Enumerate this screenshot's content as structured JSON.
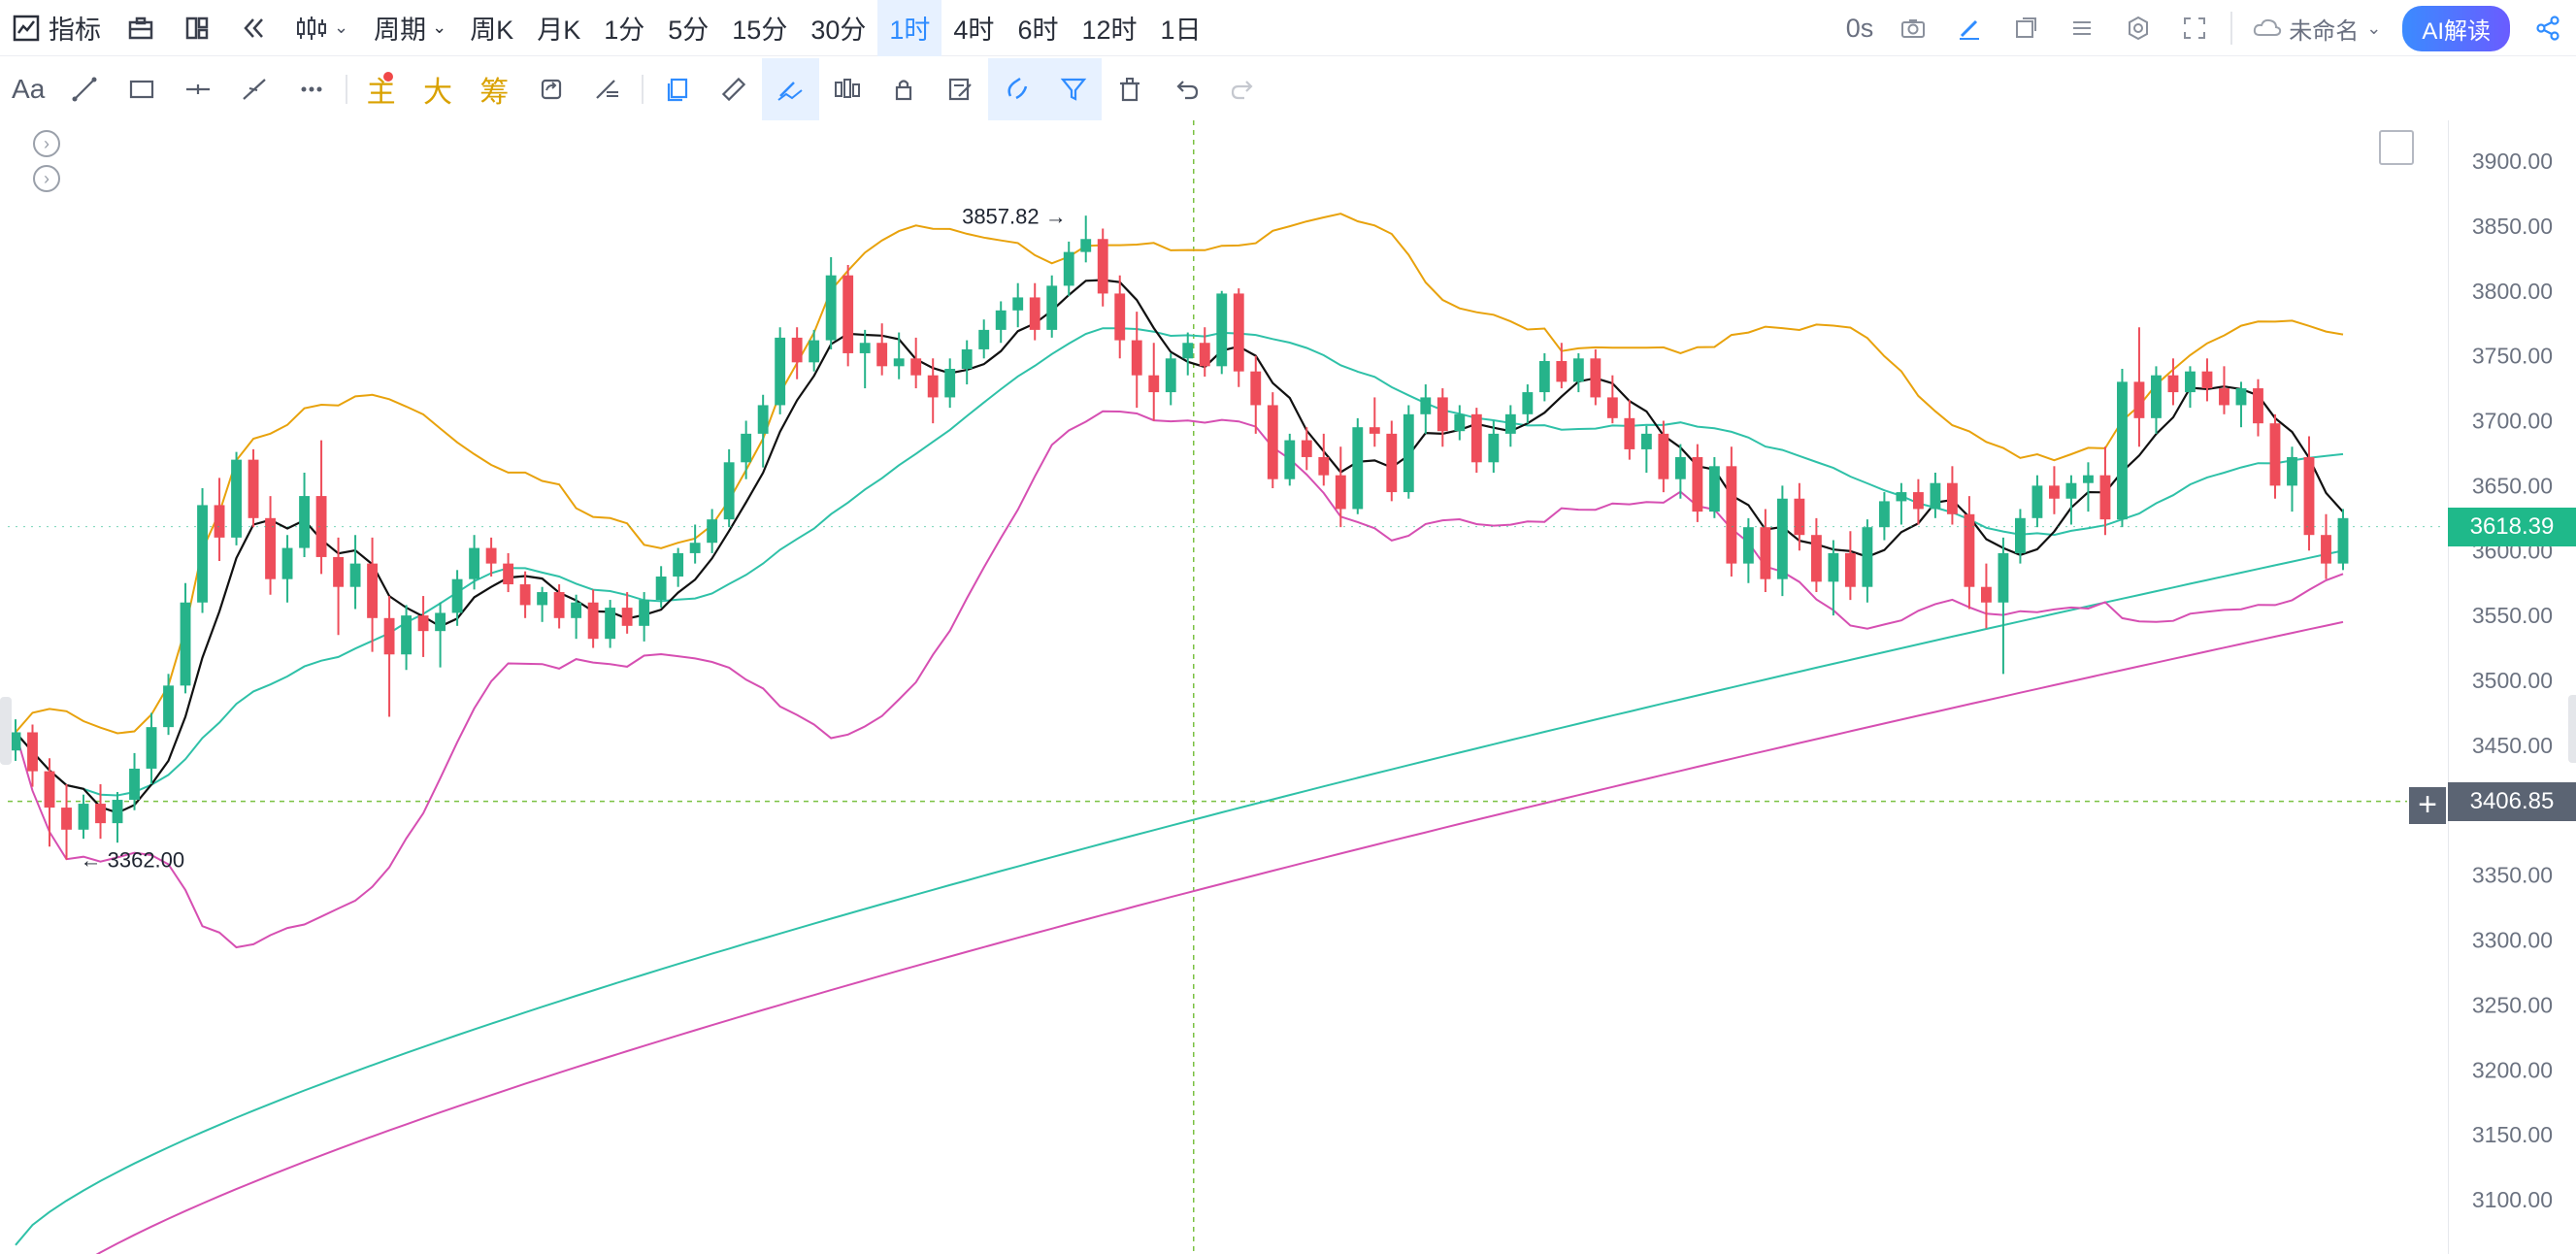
{
  "toolbar": {
    "indicator_label": "指标",
    "period_label": "周期",
    "periods": [
      "周K",
      "月K",
      "1分",
      "5分",
      "15分",
      "30分",
      "1时",
      "4时",
      "6时",
      "12时",
      "1日"
    ],
    "active_period": "1时",
    "latency": "0s",
    "layout_name": "未命名",
    "ai_label": "AI解读"
  },
  "drawing_tools": {
    "text_label": "Aa",
    "main_label": "主",
    "big_label": "大",
    "chip_label": "筹"
  },
  "colors": {
    "up": "#26b38a",
    "down": "#ee4d5a",
    "ma_black": "#111111",
    "boll_upper": "#e8a20c",
    "boll_lower": "#d64fb2",
    "ma_teal": "#2fc1a8",
    "grid_dash": "#7bc143",
    "price_tag": "#1fb98a",
    "cross_tag": "#5b6473"
  },
  "chart_data": {
    "type": "candlestick",
    "symbol": "",
    "interval": "1时",
    "y_axis": {
      "min": 3080,
      "max": 3930,
      "ticks": [
        3900,
        3850,
        3800,
        3750,
        3700,
        3650,
        3600,
        3550,
        3500,
        3450,
        3400,
        3350,
        3300,
        3250,
        3200,
        3150,
        3100
      ],
      "tick_labels": [
        "3900.00",
        "3850.00",
        "3800.00",
        "3750.00",
        "3700.00",
        "3650.00",
        "3600.00",
        "3550.00",
        "3500.00",
        "3450.00",
        "3400.00",
        "3350.00",
        "3300.00",
        "3250.00",
        "3200.00",
        "3150.00",
        "3100.00"
      ]
    },
    "last_price": 3618.39,
    "last_price_label": "3618.39",
    "crosshair_price": 3406.85,
    "crosshair_label": "3406.85",
    "crosshair_bar_index": 69,
    "annotations": [
      {
        "label": "3857.82",
        "price": 3857.82,
        "bar_index": 63,
        "side": "left"
      },
      {
        "label": "3362.00",
        "price": 3362.0,
        "bar_index": 3,
        "side": "right"
      }
    ],
    "candles": [
      [
        3446,
        3470,
        3438,
        3460
      ],
      [
        3460,
        3466,
        3418,
        3430
      ],
      [
        3430,
        3440,
        3372,
        3402
      ],
      [
        3402,
        3420,
        3362,
        3385
      ],
      [
        3385,
        3412,
        3378,
        3405
      ],
      [
        3405,
        3420,
        3378,
        3390
      ],
      [
        3390,
        3414,
        3375,
        3408
      ],
      [
        3408,
        3444,
        3400,
        3432
      ],
      [
        3432,
        3475,
        3420,
        3464
      ],
      [
        3464,
        3505,
        3458,
        3496
      ],
      [
        3496,
        3575,
        3490,
        3560
      ],
      [
        3560,
        3648,
        3552,
        3635
      ],
      [
        3635,
        3656,
        3592,
        3610
      ],
      [
        3610,
        3676,
        3604,
        3670
      ],
      [
        3670,
        3678,
        3618,
        3625
      ],
      [
        3625,
        3642,
        3566,
        3578
      ],
      [
        3578,
        3612,
        3560,
        3602
      ],
      [
        3602,
        3660,
        3595,
        3642
      ],
      [
        3642,
        3685,
        3582,
        3595
      ],
      [
        3595,
        3610,
        3535,
        3572
      ],
      [
        3572,
        3612,
        3555,
        3590
      ],
      [
        3590,
        3610,
        3522,
        3548
      ],
      [
        3548,
        3565,
        3472,
        3520
      ],
      [
        3520,
        3558,
        3508,
        3550
      ],
      [
        3550,
        3565,
        3518,
        3538
      ],
      [
        3538,
        3560,
        3510,
        3552
      ],
      [
        3552,
        3585,
        3542,
        3578
      ],
      [
        3578,
        3612,
        3570,
        3602
      ],
      [
        3602,
        3610,
        3580,
        3590
      ],
      [
        3590,
        3598,
        3568,
        3574
      ],
      [
        3574,
        3584,
        3548,
        3558
      ],
      [
        3558,
        3572,
        3545,
        3568
      ],
      [
        3568,
        3574,
        3540,
        3548
      ],
      [
        3548,
        3566,
        3532,
        3560
      ],
      [
        3560,
        3570,
        3525,
        3532
      ],
      [
        3532,
        3562,
        3525,
        3556
      ],
      [
        3556,
        3568,
        3536,
        3542
      ],
      [
        3542,
        3568,
        3530,
        3562
      ],
      [
        3562,
        3588,
        3556,
        3580
      ],
      [
        3580,
        3602,
        3572,
        3598
      ],
      [
        3598,
        3620,
        3590,
        3606
      ],
      [
        3606,
        3632,
        3598,
        3624
      ],
      [
        3624,
        3678,
        3618,
        3668
      ],
      [
        3668,
        3700,
        3655,
        3690
      ],
      [
        3690,
        3720,
        3664,
        3712
      ],
      [
        3712,
        3772,
        3705,
        3764
      ],
      [
        3764,
        3772,
        3732,
        3745
      ],
      [
        3745,
        3770,
        3738,
        3762
      ],
      [
        3762,
        3826,
        3755,
        3812
      ],
      [
        3812,
        3820,
        3742,
        3752
      ],
      [
        3752,
        3770,
        3725,
        3760
      ],
      [
        3760,
        3775,
        3735,
        3742
      ],
      [
        3742,
        3768,
        3732,
        3748
      ],
      [
        3748,
        3764,
        3725,
        3735
      ],
      [
        3735,
        3748,
        3698,
        3718
      ],
      [
        3718,
        3748,
        3710,
        3740
      ],
      [
        3740,
        3762,
        3728,
        3755
      ],
      [
        3755,
        3778,
        3748,
        3770
      ],
      [
        3770,
        3792,
        3760,
        3785
      ],
      [
        3785,
        3806,
        3772,
        3795
      ],
      [
        3795,
        3806,
        3762,
        3770
      ],
      [
        3770,
        3812,
        3764,
        3804
      ],
      [
        3804,
        3838,
        3796,
        3830
      ],
      [
        3830,
        3858,
        3822,
        3840
      ],
      [
        3840,
        3848,
        3788,
        3798
      ],
      [
        3798,
        3812,
        3748,
        3762
      ],
      [
        3762,
        3784,
        3710,
        3735
      ],
      [
        3735,
        3760,
        3700,
        3722
      ],
      [
        3722,
        3752,
        3712,
        3748
      ],
      [
        3748,
        3768,
        3735,
        3760
      ],
      [
        3760,
        3772,
        3734,
        3742
      ],
      [
        3742,
        3800,
        3736,
        3798
      ],
      [
        3798,
        3802,
        3726,
        3738
      ],
      [
        3738,
        3750,
        3690,
        3712
      ],
      [
        3712,
        3722,
        3648,
        3655
      ],
      [
        3655,
        3690,
        3650,
        3685
      ],
      [
        3685,
        3695,
        3662,
        3672
      ],
      [
        3672,
        3690,
        3650,
        3658
      ],
      [
        3658,
        3680,
        3618,
        3632
      ],
      [
        3632,
        3702,
        3628,
        3695
      ],
      [
        3695,
        3718,
        3680,
        3690
      ],
      [
        3690,
        3700,
        3638,
        3645
      ],
      [
        3645,
        3712,
        3640,
        3705
      ],
      [
        3705,
        3728,
        3690,
        3718
      ],
      [
        3718,
        3725,
        3680,
        3692
      ],
      [
        3692,
        3712,
        3685,
        3705
      ],
      [
        3705,
        3710,
        3660,
        3668
      ],
      [
        3668,
        3700,
        3660,
        3690
      ],
      [
        3690,
        3712,
        3680,
        3705
      ],
      [
        3705,
        3728,
        3698,
        3722
      ],
      [
        3722,
        3752,
        3715,
        3746
      ],
      [
        3746,
        3760,
        3725,
        3730
      ],
      [
        3730,
        3752,
        3722,
        3748
      ],
      [
        3748,
        3755,
        3712,
        3718
      ],
      [
        3718,
        3735,
        3698,
        3702
      ],
      [
        3702,
        3716,
        3670,
        3678
      ],
      [
        3678,
        3696,
        3660,
        3690
      ],
      [
        3690,
        3700,
        3645,
        3655
      ],
      [
        3655,
        3682,
        3640,
        3672
      ],
      [
        3672,
        3682,
        3622,
        3630
      ],
      [
        3630,
        3672,
        3625,
        3665
      ],
      [
        3665,
        3680,
        3580,
        3590
      ],
      [
        3590,
        3625,
        3575,
        3618
      ],
      [
        3618,
        3632,
        3568,
        3578
      ],
      [
        3578,
        3650,
        3565,
        3640
      ],
      [
        3640,
        3652,
        3600,
        3612
      ],
      [
        3612,
        3625,
        3568,
        3576
      ],
      [
        3576,
        3608,
        3550,
        3598
      ],
      [
        3598,
        3615,
        3562,
        3572
      ],
      [
        3572,
        3624,
        3560,
        3618
      ],
      [
        3618,
        3645,
        3608,
        3638
      ],
      [
        3638,
        3652,
        3620,
        3645
      ],
      [
        3645,
        3655,
        3620,
        3632
      ],
      [
        3632,
        3660,
        3625,
        3652
      ],
      [
        3652,
        3665,
        3620,
        3628
      ],
      [
        3628,
        3642,
        3555,
        3572
      ],
      [
        3572,
        3590,
        3540,
        3560
      ],
      [
        3560,
        3610,
        3505,
        3598
      ],
      [
        3598,
        3632,
        3590,
        3625
      ],
      [
        3625,
        3658,
        3618,
        3650
      ],
      [
        3650,
        3665,
        3628,
        3640
      ],
      [
        3640,
        3658,
        3620,
        3652
      ],
      [
        3652,
        3668,
        3630,
        3658
      ],
      [
        3658,
        3680,
        3612,
        3624
      ],
      [
        3624,
        3740,
        3618,
        3730
      ],
      [
        3730,
        3772,
        3680,
        3702
      ],
      [
        3702,
        3742,
        3690,
        3735
      ],
      [
        3735,
        3748,
        3712,
        3722
      ],
      [
        3722,
        3742,
        3710,
        3738
      ],
      [
        3738,
        3748,
        3715,
        3725
      ],
      [
        3725,
        3742,
        3705,
        3712
      ],
      [
        3712,
        3730,
        3695,
        3725
      ],
      [
        3725,
        3732,
        3688,
        3698
      ],
      [
        3698,
        3705,
        3640,
        3650
      ],
      [
        3650,
        3680,
        3630,
        3672
      ],
      [
        3672,
        3688,
        3600,
        3612
      ],
      [
        3612,
        3628,
        3578,
        3590
      ],
      [
        3590,
        3632,
        3585,
        3625
      ]
    ]
  }
}
